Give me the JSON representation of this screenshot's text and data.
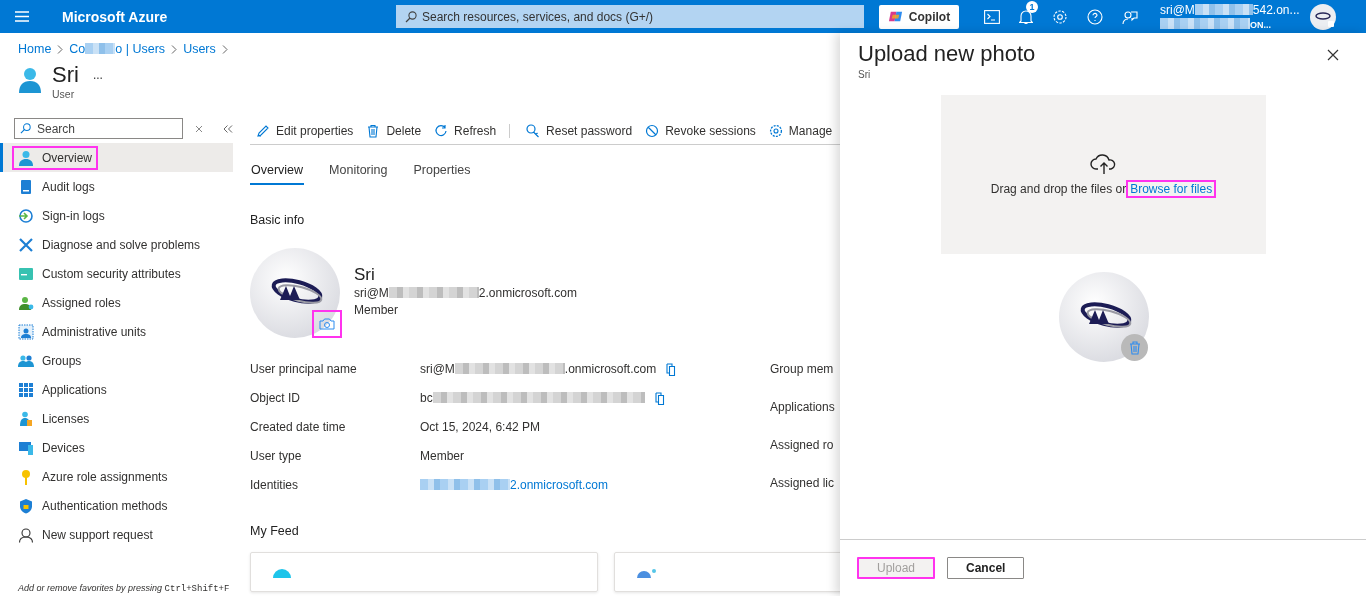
{
  "topbar": {
    "brand": "Microsoft Azure",
    "search": {
      "placeholder": "Search resources, services, and docs (G+/)"
    },
    "copilot": "Copilot",
    "notifications": "1",
    "account": {
      "line1_before": "sri@M",
      "line1_after": "542.on...",
      "line2_after": "ON..."
    }
  },
  "breadcrumb": [
    {
      "label": "Home"
    },
    {
      "before": "Co",
      "after": "o | Users"
    },
    {
      "label": "Users"
    }
  ],
  "page": {
    "title": "Sri",
    "subtitle": "User",
    "more": "..."
  },
  "sidebar": {
    "search": {
      "placeholder": "Search"
    },
    "items": [
      {
        "label": "Overview",
        "selected": true,
        "annotated": true,
        "kind": "user"
      },
      {
        "label": "Audit logs",
        "selected": false,
        "annotated": false,
        "kind": "log"
      },
      {
        "label": "Sign-in logs",
        "selected": false,
        "annotated": false,
        "kind": "signin"
      },
      {
        "label": "Diagnose and solve problems",
        "selected": false,
        "annotated": false,
        "kind": "tools"
      },
      {
        "label": "Custom security attributes",
        "selected": false,
        "annotated": false,
        "kind": "card"
      },
      {
        "label": "Assigned roles",
        "selected": false,
        "annotated": false,
        "kind": "roles"
      },
      {
        "label": "Administrative units",
        "selected": false,
        "annotated": false,
        "kind": "units"
      },
      {
        "label": "Groups",
        "selected": false,
        "annotated": false,
        "kind": "groups"
      },
      {
        "label": "Applications",
        "selected": false,
        "annotated": false,
        "kind": "apps"
      },
      {
        "label": "Licenses",
        "selected": false,
        "annotated": false,
        "kind": "license"
      },
      {
        "label": "Devices",
        "selected": false,
        "annotated": false,
        "kind": "devices"
      },
      {
        "label": "Azure role assignments",
        "selected": false,
        "annotated": false,
        "kind": "key"
      },
      {
        "label": "Authentication methods",
        "selected": false,
        "annotated": false,
        "kind": "shield"
      },
      {
        "label": "New support request",
        "selected": false,
        "annotated": false,
        "kind": "support"
      }
    ],
    "note": {
      "text": "Add or remove favorites by pressing ",
      "shortcut": "Ctrl+Shift+F"
    }
  },
  "toolbar": [
    {
      "label": "Edit properties",
      "kind": "edit"
    },
    {
      "label": "Delete",
      "kind": "delete"
    },
    {
      "label": "Refresh",
      "kind": "refresh"
    },
    {
      "label": "Reset password",
      "kind": "key"
    },
    {
      "label": "Revoke sessions",
      "kind": "block"
    },
    {
      "label": "Manage",
      "kind": "gear"
    }
  ],
  "tabs": [
    {
      "label": "Overview",
      "selected": true
    },
    {
      "label": "Monitoring",
      "selected": false
    },
    {
      "label": "Properties",
      "selected": false
    }
  ],
  "basic_info": {
    "heading": "Basic info",
    "name": "Sri",
    "email": {
      "before": "sri@M",
      "after": "2.onmicrosoft.com"
    },
    "type": "Member",
    "photo_button_annotated": true,
    "properties": [
      {
        "label": "User principal name",
        "before": "sri@M",
        "after": ".onmicrosoft.com",
        "kind": "copy"
      },
      {
        "label": "Object ID",
        "before": "bc",
        "kind": "copy"
      },
      {
        "label": "Created date time",
        "value": "Oct 15, 2024, 6:42 PM",
        "kind": "text"
      },
      {
        "label": "User type",
        "value": "Member",
        "kind": "text"
      },
      {
        "label": "Identities",
        "after": "2.onmicrosoft.com",
        "kind": "link"
      }
    ],
    "side_labels": [
      "Group mem",
      "Applications",
      "Assigned ro",
      "Assigned lic"
    ]
  },
  "feed": {
    "heading": "My Feed"
  },
  "panel": {
    "title": "Upload new photo",
    "subtitle": "Sri",
    "drop_text": "Drag and drop the files or",
    "browse": {
      "label": "Browse for files",
      "annotated": true
    },
    "buttons": [
      {
        "label": "Upload",
        "kind": "primary",
        "disabled": true,
        "annotated": true
      },
      {
        "label": "Cancel",
        "kind": "secondary",
        "disabled": false,
        "annotated": false
      }
    ]
  }
}
